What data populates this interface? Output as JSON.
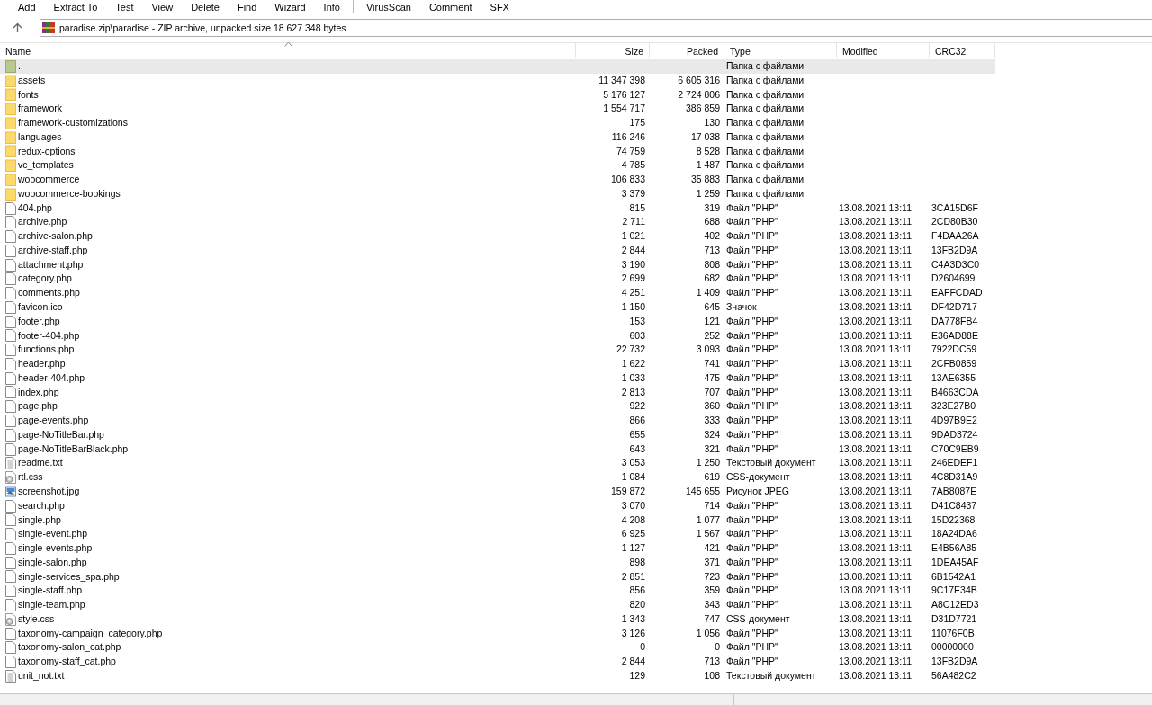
{
  "toolbar": {
    "groups": [
      [
        "Add",
        "Extract To",
        "Test",
        "View",
        "Delete",
        "Find",
        "Wizard",
        "Info"
      ],
      [
        "VirusScan",
        "Comment",
        "SFX"
      ]
    ]
  },
  "address": {
    "path": "paradise.zip\\paradise - ZIP archive, unpacked size 18 627 348 bytes"
  },
  "table": {
    "columns": [
      {
        "label": "Name",
        "sorted": true
      },
      {
        "label": "Size",
        "sorted": false
      },
      {
        "label": "Packed",
        "sorted": false
      },
      {
        "label": "Type",
        "sorted": false
      },
      {
        "label": "Modified",
        "sorted": false
      },
      {
        "label": "CRC32",
        "sorted": false
      }
    ],
    "rows": [
      {
        "kind": "up",
        "name": "..",
        "type": "Папка с файлами",
        "selected": true
      },
      {
        "kind": "folder",
        "name": "assets",
        "size": "11 347 398",
        "packed": "6 605 316",
        "type": "Папка с файлами",
        "selected": false
      },
      {
        "kind": "folder",
        "name": "fonts",
        "size": "5 176 127",
        "packed": "2 724 806",
        "type": "Папка с файлами",
        "selected": false
      },
      {
        "kind": "folder",
        "name": "framework",
        "size": "1 554 717",
        "packed": "386 859",
        "type": "Папка с файлами",
        "selected": false
      },
      {
        "kind": "folder",
        "name": "framework-customizations",
        "size": "175",
        "packed": "130",
        "type": "Папка с файлами",
        "selected": false
      },
      {
        "kind": "folder",
        "name": "languages",
        "size": "116 246",
        "packed": "17 038",
        "type": "Папка с файлами",
        "selected": false
      },
      {
        "kind": "folder",
        "name": "redux-options",
        "size": "74 759",
        "packed": "8 528",
        "type": "Папка с файлами",
        "selected": false
      },
      {
        "kind": "folder",
        "name": "vc_templates",
        "size": "4 785",
        "packed": "1 487",
        "type": "Папка с файлами",
        "selected": false
      },
      {
        "kind": "folder",
        "name": "woocommerce",
        "size": "106 833",
        "packed": "35 883",
        "type": "Папка с файлами",
        "selected": false
      },
      {
        "kind": "folder",
        "name": "woocommerce-bookings",
        "size": "3 379",
        "packed": "1 259",
        "type": "Папка с файлами",
        "selected": false
      },
      {
        "kind": "file",
        "name": "404.php",
        "size": "815",
        "packed": "319",
        "type": "Файл \"PHP\"",
        "modified": "13.08.2021 13:11",
        "crc": "3CA15D6F",
        "selected": false
      },
      {
        "kind": "file",
        "name": "archive.php",
        "size": "2 711",
        "packed": "688",
        "type": "Файл \"PHP\"",
        "modified": "13.08.2021 13:11",
        "crc": "2CD80B30",
        "selected": false
      },
      {
        "kind": "file",
        "name": "archive-salon.php",
        "size": "1 021",
        "packed": "402",
        "type": "Файл \"PHP\"",
        "modified": "13.08.2021 13:11",
        "crc": "F4DAA26A",
        "selected": false
      },
      {
        "kind": "file",
        "name": "archive-staff.php",
        "size": "2 844",
        "packed": "713",
        "type": "Файл \"PHP\"",
        "modified": "13.08.2021 13:11",
        "crc": "13FB2D9A",
        "selected": false
      },
      {
        "kind": "file",
        "name": "attachment.php",
        "size": "3 190",
        "packed": "808",
        "type": "Файл \"PHP\"",
        "modified": "13.08.2021 13:11",
        "crc": "C4A3D3C0",
        "selected": false
      },
      {
        "kind": "file",
        "name": "category.php",
        "size": "2 699",
        "packed": "682",
        "type": "Файл \"PHP\"",
        "modified": "13.08.2021 13:11",
        "crc": "D2604699",
        "selected": false
      },
      {
        "kind": "file",
        "name": "comments.php",
        "size": "4 251",
        "packed": "1 409",
        "type": "Файл \"PHP\"",
        "modified": "13.08.2021 13:11",
        "crc": "EAFFCDAD",
        "selected": false
      },
      {
        "kind": "file",
        "name": "favicon.ico",
        "size": "1 150",
        "packed": "645",
        "type": "Значок",
        "modified": "13.08.2021 13:11",
        "crc": "DF42D717",
        "selected": false
      },
      {
        "kind": "file",
        "name": "footer.php",
        "size": "153",
        "packed": "121",
        "type": "Файл \"PHP\"",
        "modified": "13.08.2021 13:11",
        "crc": "DA778FB4",
        "selected": false
      },
      {
        "kind": "file",
        "name": "footer-404.php",
        "size": "603",
        "packed": "252",
        "type": "Файл \"PHP\"",
        "modified": "13.08.2021 13:11",
        "crc": "E36AD88E",
        "selected": false
      },
      {
        "kind": "file",
        "name": "functions.php",
        "size": "22 732",
        "packed": "3 093",
        "type": "Файл \"PHP\"",
        "modified": "13.08.2021 13:11",
        "crc": "7922DC59",
        "selected": false
      },
      {
        "kind": "file",
        "name": "header.php",
        "size": "1 622",
        "packed": "741",
        "type": "Файл \"PHP\"",
        "modified": "13.08.2021 13:11",
        "crc": "2CFB0859",
        "selected": false
      },
      {
        "kind": "file",
        "name": "header-404.php",
        "size": "1 033",
        "packed": "475",
        "type": "Файл \"PHP\"",
        "modified": "13.08.2021 13:11",
        "crc": "13AE6355",
        "selected": false
      },
      {
        "kind": "file",
        "name": "index.php",
        "size": "2 813",
        "packed": "707",
        "type": "Файл \"PHP\"",
        "modified": "13.08.2021 13:11",
        "crc": "B4663CDA",
        "selected": false
      },
      {
        "kind": "file",
        "name": "page.php",
        "size": "922",
        "packed": "360",
        "type": "Файл \"PHP\"",
        "modified": "13.08.2021 13:11",
        "crc": "323E27B0",
        "selected": false
      },
      {
        "kind": "file",
        "name": "page-events.php",
        "size": "866",
        "packed": "333",
        "type": "Файл \"PHP\"",
        "modified": "13.08.2021 13:11",
        "crc": "4D97B9E2",
        "selected": false
      },
      {
        "kind": "file",
        "name": "page-NoTitleBar.php",
        "size": "655",
        "packed": "324",
        "type": "Файл \"PHP\"",
        "modified": "13.08.2021 13:11",
        "crc": "9DAD3724",
        "selected": false
      },
      {
        "kind": "file",
        "name": "page-NoTitleBarBlack.php",
        "size": "643",
        "packed": "321",
        "type": "Файл \"PHP\"",
        "modified": "13.08.2021 13:11",
        "crc": "C70C9EB9",
        "selected": false
      },
      {
        "kind": "text",
        "name": "readme.txt",
        "size": "3 053",
        "packed": "1 250",
        "type": "Текстовый документ",
        "modified": "13.08.2021 13:11",
        "crc": "246EDEF1",
        "selected": false
      },
      {
        "kind": "css",
        "name": "rtl.css",
        "size": "1 084",
        "packed": "619",
        "type": "CSS-документ",
        "modified": "13.08.2021 13:11",
        "crc": "4C8D31A9",
        "selected": false
      },
      {
        "kind": "image",
        "name": "screenshot.jpg",
        "size": "159 872",
        "packed": "145 655",
        "type": "Рисунок JPEG",
        "modified": "13.08.2021 13:11",
        "crc": "7AB8087E",
        "selected": false
      },
      {
        "kind": "file",
        "name": "search.php",
        "size": "3 070",
        "packed": "714",
        "type": "Файл \"PHP\"",
        "modified": "13.08.2021 13:11",
        "crc": "D41C8437",
        "selected": false
      },
      {
        "kind": "file",
        "name": "single.php",
        "size": "4 208",
        "packed": "1 077",
        "type": "Файл \"PHP\"",
        "modified": "13.08.2021 13:11",
        "crc": "15D22368",
        "selected": false
      },
      {
        "kind": "file",
        "name": "single-event.php",
        "size": "6 925",
        "packed": "1 567",
        "type": "Файл \"PHP\"",
        "modified": "13.08.2021 13:11",
        "crc": "18A24DA6",
        "selected": false
      },
      {
        "kind": "file",
        "name": "single-events.php",
        "size": "1 127",
        "packed": "421",
        "type": "Файл \"PHP\"",
        "modified": "13.08.2021 13:11",
        "crc": "E4B56A85",
        "selected": false
      },
      {
        "kind": "file",
        "name": "single-salon.php",
        "size": "898",
        "packed": "371",
        "type": "Файл \"PHP\"",
        "modified": "13.08.2021 13:11",
        "crc": "1DEA45AF",
        "selected": false
      },
      {
        "kind": "file",
        "name": "single-services_spa.php",
        "size": "2 851",
        "packed": "723",
        "type": "Файл \"PHP\"",
        "modified": "13.08.2021 13:11",
        "crc": "6B1542A1",
        "selected": false
      },
      {
        "kind": "file",
        "name": "single-staff.php",
        "size": "856",
        "packed": "359",
        "type": "Файл \"PHP\"",
        "modified": "13.08.2021 13:11",
        "crc": "9C17E34B",
        "selected": false
      },
      {
        "kind": "file",
        "name": "single-team.php",
        "size": "820",
        "packed": "343",
        "type": "Файл \"PHP\"",
        "modified": "13.08.2021 13:11",
        "crc": "A8C12ED3",
        "selected": false
      },
      {
        "kind": "css",
        "name": "style.css",
        "size": "1 343",
        "packed": "747",
        "type": "CSS-документ",
        "modified": "13.08.2021 13:11",
        "crc": "D31D7721",
        "selected": false
      },
      {
        "kind": "file",
        "name": "taxonomy-campaign_category.php",
        "size": "3 126",
        "packed": "1 056",
        "type": "Файл \"PHP\"",
        "modified": "13.08.2021 13:11",
        "crc": "11076F0B",
        "selected": false
      },
      {
        "kind": "file",
        "name": "taxonomy-salon_cat.php",
        "size": "0",
        "packed": "0",
        "type": "Файл \"PHP\"",
        "modified": "13.08.2021 13:11",
        "crc": "00000000",
        "selected": false
      },
      {
        "kind": "file",
        "name": "taxonomy-staff_cat.php",
        "size": "2 844",
        "packed": "713",
        "type": "Файл \"PHP\"",
        "modified": "13.08.2021 13:11",
        "crc": "13FB2D9A",
        "selected": false
      },
      {
        "kind": "text",
        "name": "unit_not.txt",
        "size": "129",
        "packed": "108",
        "type": "Текстовый документ",
        "modified": "13.08.2021 13:11",
        "crc": "56A482C2",
        "selected": false
      }
    ]
  }
}
